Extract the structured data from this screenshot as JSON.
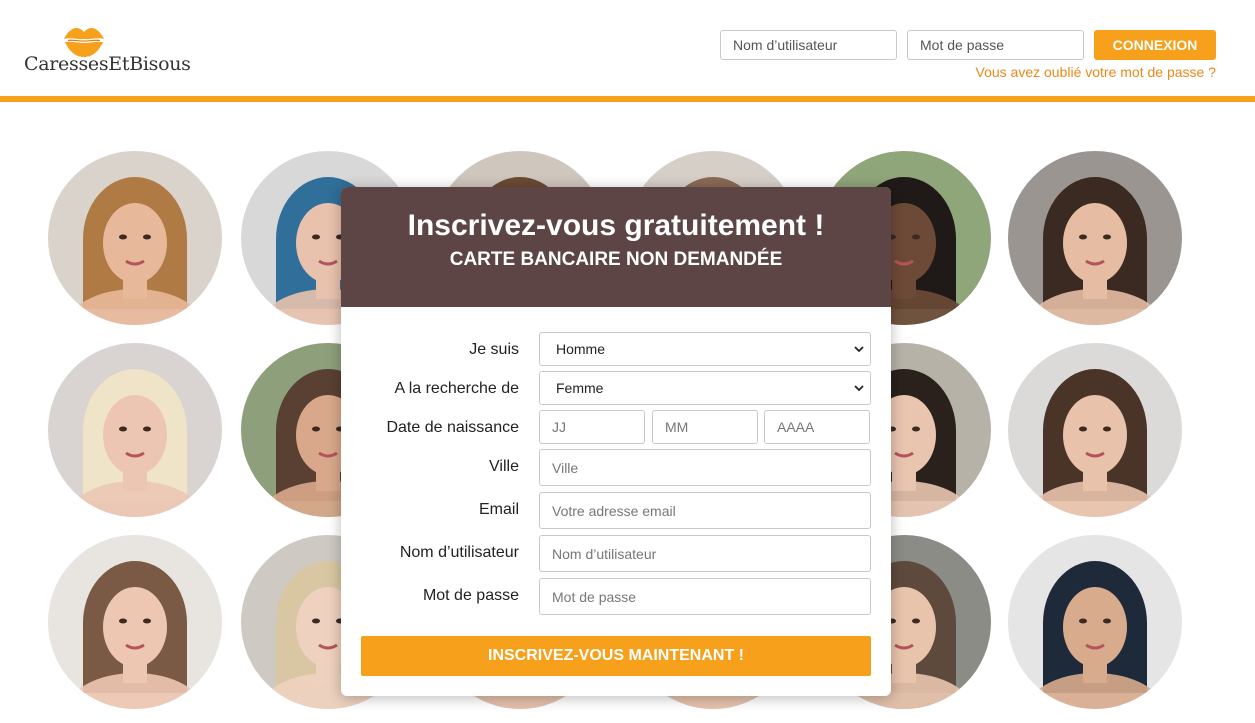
{
  "brand": {
    "name": "CaressesEtBisous",
    "accent_color": "#f7a01c",
    "header_card_color": "#5d4545"
  },
  "header": {
    "username_placeholder": "Nom d’utilisateur",
    "password_placeholder": "Mot de passe",
    "login_label": "CONNEXION",
    "forgot_link": "Vous avez oublié votre mot de passe ?"
  },
  "signup": {
    "title": "Inscrivez-vous gratuitement !",
    "subtitle": "CARTE BANCAIRE NON DEMANDÉE",
    "fields": {
      "gender": {
        "label": "Je suis",
        "value": "Homme"
      },
      "seeking": {
        "label": "A la recherche de",
        "value": "Femme"
      },
      "birthdate": {
        "label": "Date de naissance",
        "day_placeholder": "JJ",
        "month_placeholder": "MM",
        "year_placeholder": "AAAA"
      },
      "city": {
        "label": "Ville",
        "placeholder": "Ville"
      },
      "email": {
        "label": "Email",
        "placeholder": "Votre adresse email"
      },
      "username": {
        "label": "Nom d’utilisateur",
        "placeholder": "Nom d’utilisateur"
      },
      "password": {
        "label": "Mot de passe",
        "placeholder": "Mot de passe"
      }
    },
    "submit_label": "INSCRIVEZ-VOUS MAINTENANT !"
  },
  "gallery": {
    "icon": "profile-photo",
    "photos": [
      {
        "hair": "#b07a44",
        "bg": "#d9d3cc",
        "skin": "#e8b89a"
      },
      {
        "hair": "#2f6f9a",
        "bg": "#d8d8d8",
        "skin": "#e9c2ad"
      },
      {
        "hair": "#6b4a33",
        "bg": "#cfc6bd",
        "skin": "#e2b596"
      },
      {
        "hair": "#8a6a55",
        "bg": "#d6cfc8",
        "skin": "#ecc8b3"
      },
      {
        "hair": "#1f1a17",
        "bg": "#8fa57a",
        "skin": "#6d4a37"
      },
      {
        "hair": "#3a2a22",
        "bg": "#9a9590",
        "skin": "#e6bda3"
      },
      {
        "hair": "#efe3c8",
        "bg": "#d9d4d2",
        "skin": "#ecc6b2"
      },
      {
        "hair": "#5a4032",
        "bg": "#8d9f7b",
        "skin": "#d9a88b"
      },
      {
        "hair": "#6d5445",
        "bg": "#c8c1b8",
        "skin": "#e8c0a6"
      },
      {
        "hair": "#4e3a2e",
        "bg": "#d4cdc6",
        "skin": "#e5bba2"
      },
      {
        "hair": "#2a211c",
        "bg": "#b7b2a8",
        "skin": "#e9c5b0"
      },
      {
        "hair": "#4a3428",
        "bg": "#dcdad8",
        "skin": "#e8c2ab"
      },
      {
        "hair": "#7a5a45",
        "bg": "#e8e4e0",
        "skin": "#edc7b1"
      },
      {
        "hair": "#d8c7a2",
        "bg": "#cfc9c3",
        "skin": "#efd1bf"
      },
      {
        "hair": "#5b4335",
        "bg": "#d7d1cb",
        "skin": "#e6bea6"
      },
      {
        "hair": "#6a4c3b",
        "bg": "#d2ccc5",
        "skin": "#e7c1a9"
      },
      {
        "hair": "#5e4a3d",
        "bg": "#8b8c86",
        "skin": "#e9c4ad"
      },
      {
        "hair": "#1e2a3a",
        "bg": "#e5e5e5",
        "skin": "#d8ab8d"
      }
    ]
  }
}
